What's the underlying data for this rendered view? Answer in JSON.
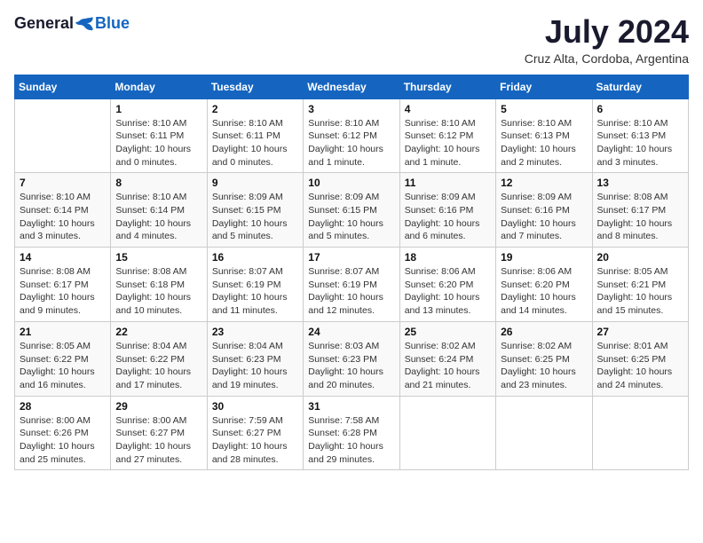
{
  "header": {
    "logo_general": "General",
    "logo_blue": "Blue",
    "month_title": "July 2024",
    "location": "Cruz Alta, Cordoba, Argentina"
  },
  "days_of_week": [
    "Sunday",
    "Monday",
    "Tuesday",
    "Wednesday",
    "Thursday",
    "Friday",
    "Saturday"
  ],
  "weeks": [
    [
      {
        "day": "",
        "info": ""
      },
      {
        "day": "1",
        "info": "Sunrise: 8:10 AM\nSunset: 6:11 PM\nDaylight: 10 hours\nand 0 minutes."
      },
      {
        "day": "2",
        "info": "Sunrise: 8:10 AM\nSunset: 6:11 PM\nDaylight: 10 hours\nand 0 minutes."
      },
      {
        "day": "3",
        "info": "Sunrise: 8:10 AM\nSunset: 6:12 PM\nDaylight: 10 hours\nand 1 minute."
      },
      {
        "day": "4",
        "info": "Sunrise: 8:10 AM\nSunset: 6:12 PM\nDaylight: 10 hours\nand 1 minute."
      },
      {
        "day": "5",
        "info": "Sunrise: 8:10 AM\nSunset: 6:13 PM\nDaylight: 10 hours\nand 2 minutes."
      },
      {
        "day": "6",
        "info": "Sunrise: 8:10 AM\nSunset: 6:13 PM\nDaylight: 10 hours\nand 3 minutes."
      }
    ],
    [
      {
        "day": "7",
        "info": "Sunrise: 8:10 AM\nSunset: 6:14 PM\nDaylight: 10 hours\nand 3 minutes."
      },
      {
        "day": "8",
        "info": "Sunrise: 8:10 AM\nSunset: 6:14 PM\nDaylight: 10 hours\nand 4 minutes."
      },
      {
        "day": "9",
        "info": "Sunrise: 8:09 AM\nSunset: 6:15 PM\nDaylight: 10 hours\nand 5 minutes."
      },
      {
        "day": "10",
        "info": "Sunrise: 8:09 AM\nSunset: 6:15 PM\nDaylight: 10 hours\nand 5 minutes."
      },
      {
        "day": "11",
        "info": "Sunrise: 8:09 AM\nSunset: 6:16 PM\nDaylight: 10 hours\nand 6 minutes."
      },
      {
        "day": "12",
        "info": "Sunrise: 8:09 AM\nSunset: 6:16 PM\nDaylight: 10 hours\nand 7 minutes."
      },
      {
        "day": "13",
        "info": "Sunrise: 8:08 AM\nSunset: 6:17 PM\nDaylight: 10 hours\nand 8 minutes."
      }
    ],
    [
      {
        "day": "14",
        "info": "Sunrise: 8:08 AM\nSunset: 6:17 PM\nDaylight: 10 hours\nand 9 minutes."
      },
      {
        "day": "15",
        "info": "Sunrise: 8:08 AM\nSunset: 6:18 PM\nDaylight: 10 hours\nand 10 minutes."
      },
      {
        "day": "16",
        "info": "Sunrise: 8:07 AM\nSunset: 6:19 PM\nDaylight: 10 hours\nand 11 minutes."
      },
      {
        "day": "17",
        "info": "Sunrise: 8:07 AM\nSunset: 6:19 PM\nDaylight: 10 hours\nand 12 minutes."
      },
      {
        "day": "18",
        "info": "Sunrise: 8:06 AM\nSunset: 6:20 PM\nDaylight: 10 hours\nand 13 minutes."
      },
      {
        "day": "19",
        "info": "Sunrise: 8:06 AM\nSunset: 6:20 PM\nDaylight: 10 hours\nand 14 minutes."
      },
      {
        "day": "20",
        "info": "Sunrise: 8:05 AM\nSunset: 6:21 PM\nDaylight: 10 hours\nand 15 minutes."
      }
    ],
    [
      {
        "day": "21",
        "info": "Sunrise: 8:05 AM\nSunset: 6:22 PM\nDaylight: 10 hours\nand 16 minutes."
      },
      {
        "day": "22",
        "info": "Sunrise: 8:04 AM\nSunset: 6:22 PM\nDaylight: 10 hours\nand 17 minutes."
      },
      {
        "day": "23",
        "info": "Sunrise: 8:04 AM\nSunset: 6:23 PM\nDaylight: 10 hours\nand 19 minutes."
      },
      {
        "day": "24",
        "info": "Sunrise: 8:03 AM\nSunset: 6:23 PM\nDaylight: 10 hours\nand 20 minutes."
      },
      {
        "day": "25",
        "info": "Sunrise: 8:02 AM\nSunset: 6:24 PM\nDaylight: 10 hours\nand 21 minutes."
      },
      {
        "day": "26",
        "info": "Sunrise: 8:02 AM\nSunset: 6:25 PM\nDaylight: 10 hours\nand 23 minutes."
      },
      {
        "day": "27",
        "info": "Sunrise: 8:01 AM\nSunset: 6:25 PM\nDaylight: 10 hours\nand 24 minutes."
      }
    ],
    [
      {
        "day": "28",
        "info": "Sunrise: 8:00 AM\nSunset: 6:26 PM\nDaylight: 10 hours\nand 25 minutes."
      },
      {
        "day": "29",
        "info": "Sunrise: 8:00 AM\nSunset: 6:27 PM\nDaylight: 10 hours\nand 27 minutes."
      },
      {
        "day": "30",
        "info": "Sunrise: 7:59 AM\nSunset: 6:27 PM\nDaylight: 10 hours\nand 28 minutes."
      },
      {
        "day": "31",
        "info": "Sunrise: 7:58 AM\nSunset: 6:28 PM\nDaylight: 10 hours\nand 29 minutes."
      },
      {
        "day": "",
        "info": ""
      },
      {
        "day": "",
        "info": ""
      },
      {
        "day": "",
        "info": ""
      }
    ]
  ]
}
